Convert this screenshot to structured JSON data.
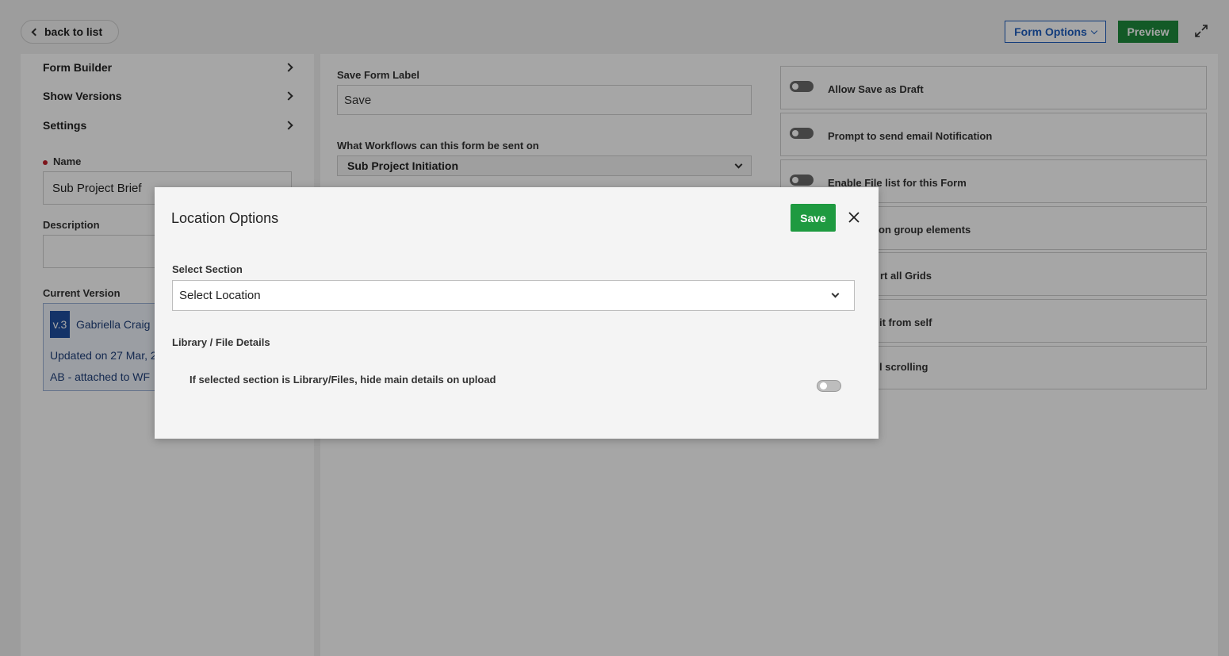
{
  "header": {
    "back_label": "back to list",
    "form_options_label": "Form Options",
    "preview_label": "Preview"
  },
  "sidebar": {
    "nav": [
      {
        "label": "Form Builder"
      },
      {
        "label": "Show Versions"
      },
      {
        "label": "Settings"
      }
    ],
    "name_label": "Name",
    "name_value": "Sub Project Brief",
    "description_label": "Description",
    "description_value": "",
    "current_version_label": "Current Version",
    "version": {
      "badge": "v.3",
      "author": "Gabriella Craig",
      "updated": "Updated on 27 Mar, 2",
      "note": "AB - attached to WF"
    }
  },
  "main": {
    "save_form_label_title": "Save Form Label",
    "save_form_label_value": "Save",
    "workflows_title": "What Workflows can this form be sent on",
    "workflow_selected": "Sub Project Initiation",
    "options": [
      {
        "label": "Allow Save as Draft"
      },
      {
        "label": "Prompt to send email Notification"
      },
      {
        "label": "Enable File list for this Form"
      },
      {
        "label": "on group elements"
      },
      {
        "label": "rt all Grids"
      },
      {
        "label": "it from self"
      },
      {
        "label": "l scrolling"
      }
    ]
  },
  "modal": {
    "title": "Location Options",
    "save_label": "Save",
    "select_section_label": "Select Section",
    "select_location_value": "Select Location",
    "library_section_label": "Library / File Details",
    "hide_details_label": "If selected section is Library/Files, hide main details on upload",
    "hide_details_enabled": false
  },
  "colors": {
    "accent_blue": "#1f5fbf",
    "primary_green": "#1e8a3c",
    "required_red": "#c0202a"
  },
  "icons": [
    "chevron-left-icon",
    "chevron-down-icon",
    "expand-icon",
    "chevron-right-icon",
    "close-icon"
  ]
}
